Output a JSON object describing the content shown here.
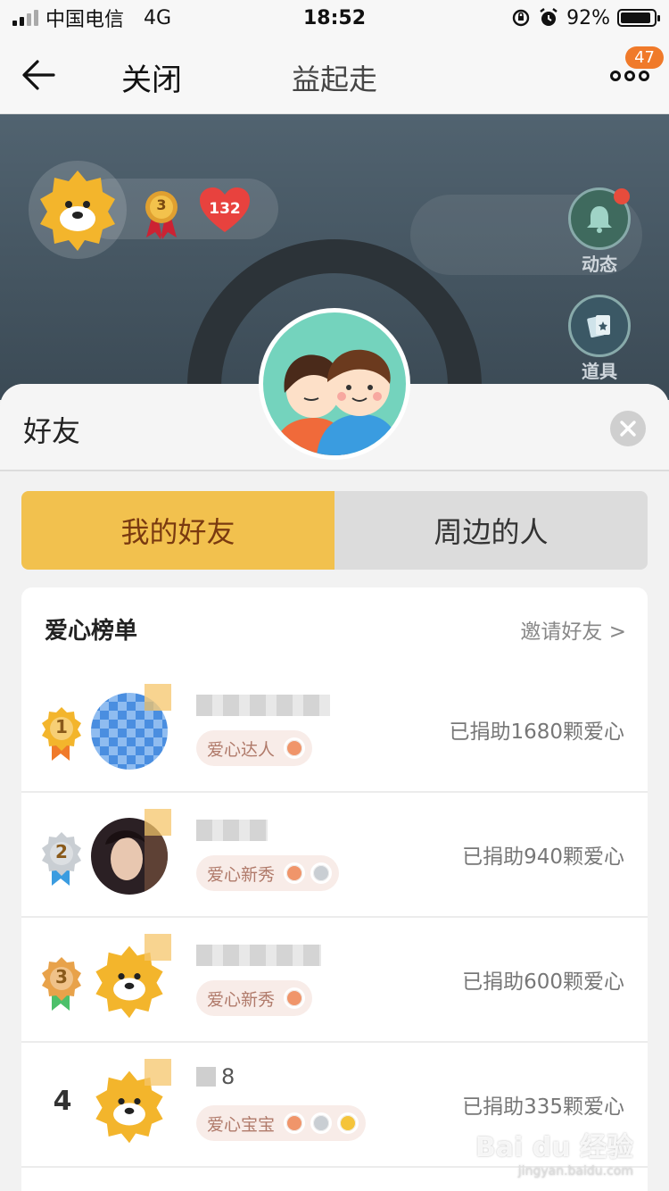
{
  "status_bar": {
    "carrier": "中国电信",
    "network": "4G",
    "time": "18:52",
    "battery": "92%",
    "battery_level": 0.92
  },
  "nav": {
    "close_label": "关闭",
    "title": "益起走",
    "more_badge": "47"
  },
  "profile": {
    "medal_count": "3",
    "heart_count": "132"
  },
  "side_buttons": {
    "feed_label": "动态",
    "props_label": "道具"
  },
  "sheet": {
    "title": "好友"
  },
  "tabs": {
    "my_friends": "我的好友",
    "nearby": "周边的人",
    "active_index": 0
  },
  "leaderboard": {
    "title": "爱心榜单",
    "invite_label": "邀请好友 >",
    "rows": [
      {
        "rank": "1",
        "name_display": "",
        "tag": "爱心达人",
        "badges": [
          "#f0956a"
        ],
        "amount": "已捐助1680颗爱心"
      },
      {
        "rank": "2",
        "name_display": "",
        "tag": "爱心新秀",
        "badges": [
          "#f0956a",
          "#c9ced3"
        ],
        "amount": "已捐助940颗爱心"
      },
      {
        "rank": "3",
        "name_display": "",
        "tag": "爱心新秀",
        "badges": [
          "#f0956a"
        ],
        "amount": "已捐助600颗爱心"
      },
      {
        "rank": "4",
        "name_display": "8",
        "tag": "爱心宝宝",
        "badges": [
          "#f0956a",
          "#c9ced3",
          "#f5c43a"
        ],
        "amount": "已捐助335颗爱心"
      }
    ]
  },
  "colors": {
    "accent": "#f2c14e",
    "badge": "#f07a2a",
    "gold": "#f3b52c",
    "silver": "#c9ced3",
    "bronze": "#e8a24a"
  },
  "watermark": {
    "brand": "Bai du 经验",
    "url": "jingyan.baidu.com"
  }
}
